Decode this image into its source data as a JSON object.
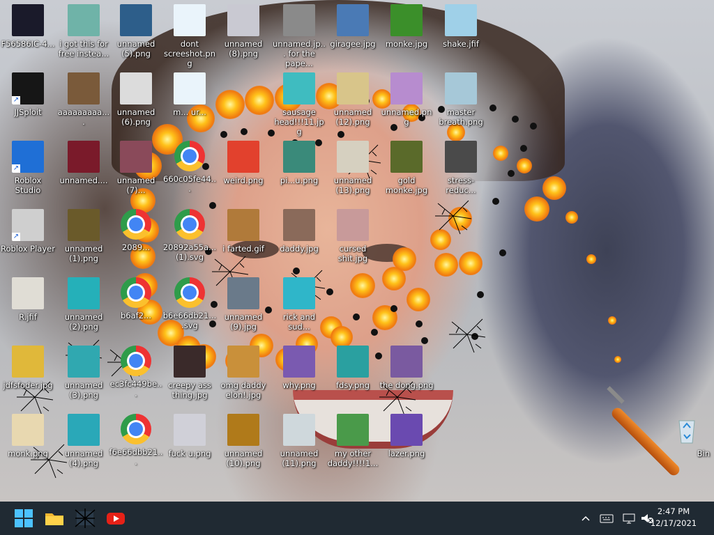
{
  "desktop_icons": [
    {
      "label": "F56586IC-4...",
      "type": "file"
    },
    {
      "label": "i got this for free instea...",
      "type": "image"
    },
    {
      "label": "unnamed (5).png",
      "type": "image"
    },
    {
      "label": "dont screeshot.png",
      "type": "image"
    },
    {
      "label": "unnamed (8).png",
      "type": "image"
    },
    {
      "label": "unnamed.jp... for the pape...",
      "type": "image"
    },
    {
      "label": "giragee.jpg",
      "type": "image"
    },
    {
      "label": "monke.jpg",
      "type": "image"
    },
    {
      "label": "shake.jfif",
      "type": "image"
    },
    {
      "label": "JJSploit",
      "type": "shortcut"
    },
    {
      "label": "aaaaaaaaa....",
      "type": "image"
    },
    {
      "label": "unnamed (6).png",
      "type": "image"
    },
    {
      "label": "m... ur...",
      "type": "image"
    },
    {
      "label": "sausage head!!!11.jpg",
      "type": "image"
    },
    {
      "label": "unnamed (12).png",
      "type": "image"
    },
    {
      "label": "unnamed.png",
      "type": "image"
    },
    {
      "label": "master breath.png",
      "type": "image"
    },
    {
      "label": "Roblox Studio",
      "type": "shortcut"
    },
    {
      "label": "unnamed....",
      "type": "image"
    },
    {
      "label": "unnamed (7)...",
      "type": "image"
    },
    {
      "label": "660c05fe44...",
      "type": "chrome"
    },
    {
      "label": "weird.png",
      "type": "image"
    },
    {
      "label": "pi...u.png",
      "type": "image"
    },
    {
      "label": "unnamed (13).png",
      "type": "image"
    },
    {
      "label": "gold monke.jpg",
      "type": "image"
    },
    {
      "label": "stress-reduc...",
      "type": "image"
    },
    {
      "label": "Roblox Player",
      "type": "shortcut"
    },
    {
      "label": "unnamed (1).png",
      "type": "image"
    },
    {
      "label": "2089...",
      "type": "chrome"
    },
    {
      "label": "20892a55a... (1).svg",
      "type": "chrome"
    },
    {
      "label": "i farted.gif",
      "type": "image"
    },
    {
      "label": "daddy.jpg",
      "type": "image"
    },
    {
      "label": "cursed shit.jpg",
      "type": "image"
    },
    {
      "label": "R.jfif",
      "type": "image"
    },
    {
      "label": "unnamed (2).png",
      "type": "image"
    },
    {
      "label": "b6af2...",
      "type": "chrome"
    },
    {
      "label": "b6e66db21... .svg",
      "type": "chrome"
    },
    {
      "label": "unnamed (9).jpg",
      "type": "image"
    },
    {
      "label": "rick and sud...",
      "type": "image"
    },
    {
      "label": "jdfsfoder.jpg",
      "type": "image"
    },
    {
      "label": "unnamed (3).png",
      "type": "image"
    },
    {
      "label": "ec3fc449be...",
      "type": "chrome"
    },
    {
      "label": "creepy ass thing.jpg",
      "type": "image"
    },
    {
      "label": "omg daddy elon!.jpg",
      "type": "image"
    },
    {
      "label": "why.png",
      "type": "image"
    },
    {
      "label": "fdsy.png",
      "type": "image"
    },
    {
      "label": "the dong.png",
      "type": "image"
    },
    {
      "label": "monk.png",
      "type": "image"
    },
    {
      "label": "unnamed (4).png",
      "type": "image"
    },
    {
      "label": "f6e66dbb21...",
      "type": "chrome"
    },
    {
      "label": "fuck u.png",
      "type": "image"
    },
    {
      "label": "unnamed (10).png",
      "type": "image"
    },
    {
      "label": "unnamed (11).png",
      "type": "image"
    },
    {
      "label": "my other daddy!!!!1...",
      "type": "image"
    },
    {
      "label": "lazer.png",
      "type": "image"
    },
    {
      "label": "Bin",
      "type": "recycle-bin"
    }
  ],
  "taskbar": {
    "start_icon": "windows-start-icon",
    "pinned": [
      {
        "name": "file-explorer-icon",
        "color": "#f2b630"
      },
      {
        "name": "scribbled-app-icon",
        "color": "#1d2a36"
      },
      {
        "name": "youtube-icon",
        "color": "#e62117"
      }
    ],
    "tray": {
      "chevron": "^",
      "keyboard_icon": "keyboard-icon",
      "network_icon": "network-icon",
      "volume_icon": "volume-muted-icon"
    },
    "clock": {
      "time": "2:47 PM",
      "date": "12/17/2021"
    }
  },
  "colors": {
    "taskbar_bg": "#202a33",
    "fire": "#ffa41a",
    "stick": "#e07a20"
  }
}
